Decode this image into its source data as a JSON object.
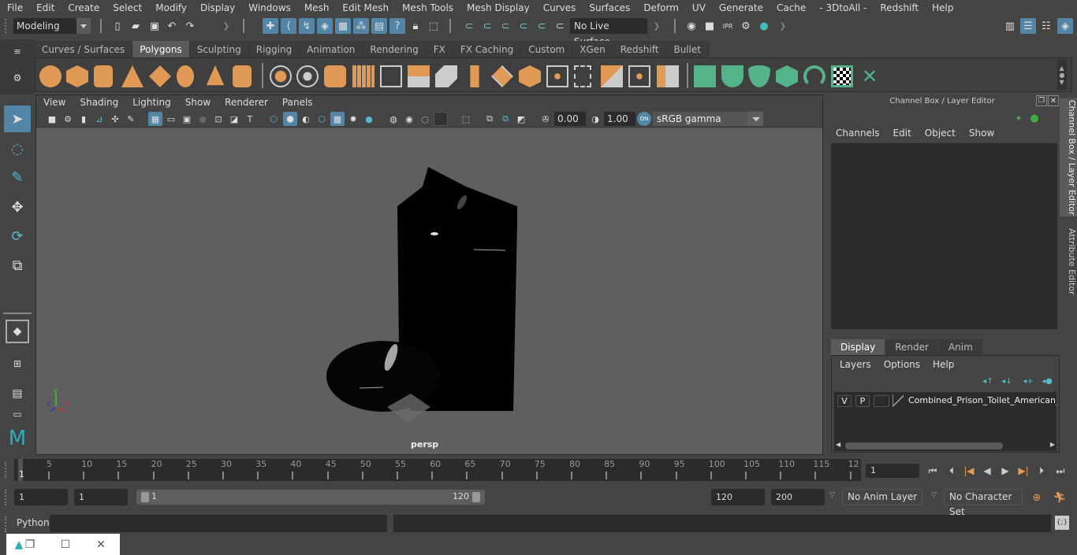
{
  "menubar": {
    "items": [
      "File",
      "Edit",
      "Create",
      "Select",
      "Modify",
      "Display",
      "Windows",
      "Mesh",
      "Edit Mesh",
      "Mesh Tools",
      "Mesh Display",
      "Curves",
      "Surfaces",
      "Deform",
      "UV",
      "Generate",
      "Cache",
      "- 3DtoAll -",
      "Redshift",
      "Help"
    ]
  },
  "statusline": {
    "mode": "Modeling",
    "live_surface": "No Live Surface",
    "icons": [
      "new-scene",
      "open-scene",
      "save-scene",
      "undo",
      "redo",
      "select-by-hierarchy",
      "select-by-object",
      "select-by-component",
      "snap-grid",
      "snap-curve",
      "snap-point",
      "snap-view-plane",
      "snap-live",
      "lock",
      "select-highlight",
      "history",
      "input-ops",
      "output-ops",
      "construction-history",
      "render-view",
      "render-frame",
      "ipr-render",
      "render-settings",
      "hypershade"
    ]
  },
  "shelf": {
    "tabs": [
      "Curves / Surfaces",
      "Polygons",
      "Sculpting",
      "Rigging",
      "Animation",
      "Rendering",
      "FX",
      "FX Caching",
      "Custom",
      "XGen",
      "Redshift",
      "Bullet"
    ],
    "active_tab": "Polygons",
    "icons": [
      "poly-sphere",
      "poly-cube",
      "poly-cylinder",
      "poly-cone",
      "poly-platonic",
      "poly-torus",
      "poly-pyramid",
      "poly-pipe",
      "combine",
      "separate",
      "mirror",
      "smooth",
      "extract",
      "bevel",
      "bridge",
      "multi-cut",
      "extrude",
      "merge",
      "bridge-edge",
      "append",
      "insert-loop",
      "offset-loop",
      "target-weld",
      "planar-uv",
      "cylindrical-uv",
      "spherical-uv",
      "automatic-uv",
      "contour-uv",
      "uv-editor",
      "unfold-uv"
    ]
  },
  "viewport": {
    "menu": [
      "View",
      "Shading",
      "Lighting",
      "Show",
      "Renderer",
      "Panels"
    ],
    "exposure": "0.00",
    "gamma": "1.00",
    "color_mgmt": "ON",
    "color_space": "sRGB gamma",
    "camera": "persp",
    "axis": {
      "x": "x",
      "y": "y",
      "z": "z"
    }
  },
  "channelbox": {
    "title": "Channel Box / Layer Editor",
    "menu": [
      "Channels",
      "Edit",
      "Object",
      "Show"
    ]
  },
  "layereditor": {
    "tabs": [
      "Display",
      "Render",
      "Anim"
    ],
    "active_tab": "Display",
    "menu": [
      "Layers",
      "Options",
      "Help"
    ],
    "layer": {
      "v": "V",
      "p": "P",
      "name": "Combined_Prison_Toilet_American_St"
    }
  },
  "sidetabs": [
    "Channel Box / Layer Editor",
    "Attribute Editor"
  ],
  "timeline": {
    "start_marker": "1",
    "ticks": [
      "5",
      "10",
      "15",
      "20",
      "25",
      "30",
      "35",
      "40",
      "45",
      "50",
      "55",
      "60",
      "65",
      "70",
      "75",
      "80",
      "85",
      "90",
      "95",
      "100",
      "105",
      "110",
      "115",
      "12"
    ],
    "current_frame": "1"
  },
  "range": {
    "start": "1",
    "playback_start": "1",
    "slider_min": "1",
    "slider_max": "120",
    "playback_end": "120",
    "end": "200",
    "anim_layer": "No Anim Layer",
    "character_set": "No Character Set"
  },
  "cmdline": {
    "label": "Python"
  }
}
